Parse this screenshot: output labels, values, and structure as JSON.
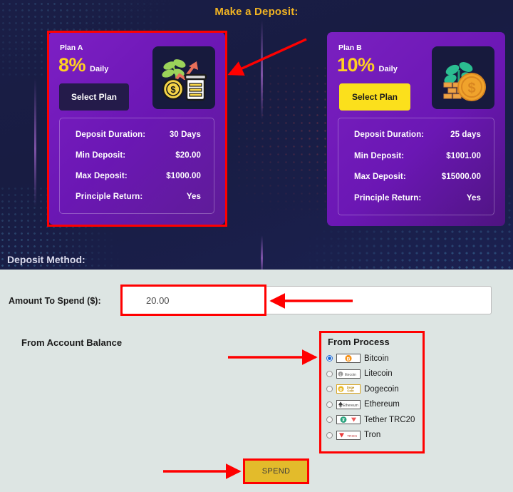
{
  "page": {
    "title": "Make a Deposit:",
    "deposit_method_label": "Deposit Method:",
    "accent_yellow": "#f0b323",
    "annotation_color": "#ff0000",
    "card_purple": "#6b17b4",
    "light_bg": "#dde5e3"
  },
  "plans": [
    {
      "name": "Plan A",
      "rate": "8%",
      "rate_unit": "Daily",
      "select_label": "Select Plan",
      "icon": "money-plant-jar-growth-icon",
      "rows": [
        {
          "key": "Deposit Duration:",
          "value": "30 Days"
        },
        {
          "key": "Min Deposit:",
          "value": "$20.00"
        },
        {
          "key": "Max Deposit:",
          "value": "$1000.00"
        },
        {
          "key": "Principle Return:",
          "value": "Yes"
        }
      ]
    },
    {
      "name": "Plan B",
      "rate": "10%",
      "rate_unit": "Daily",
      "select_label": "Select Plan",
      "icon": "money-plant-coin-growth-icon",
      "rows": [
        {
          "key": "Deposit Duration:",
          "value": "25 days"
        },
        {
          "key": "Min Deposit:",
          "value": "$1001.00"
        },
        {
          "key": "Max Deposit:",
          "value": "$15000.00"
        },
        {
          "key": "Principle Return:",
          "value": "Yes"
        }
      ]
    }
  ],
  "form": {
    "amount_label": "Amount To Spend ($):",
    "amount_value": "20.00",
    "amount_placeholder": "",
    "from_balance_label": "From Account Balance",
    "process_title": "From Process",
    "processors": [
      {
        "label": "Bitcoin",
        "selected": true,
        "icon": "bitcoin-logo-icon"
      },
      {
        "label": "Litecoin",
        "selected": false,
        "icon": "litecoin-logo-icon"
      },
      {
        "label": "Dogecoin",
        "selected": false,
        "icon": "dogecoin-logo-icon"
      },
      {
        "label": "Ethereum",
        "selected": false,
        "icon": "ethereum-logo-icon"
      },
      {
        "label": "Tether TRC20",
        "selected": false,
        "icon": "tether-trc20-logo-icon"
      },
      {
        "label": "Tron",
        "selected": false,
        "icon": "tron-logo-icon"
      }
    ],
    "spend_label": "SPEND"
  }
}
